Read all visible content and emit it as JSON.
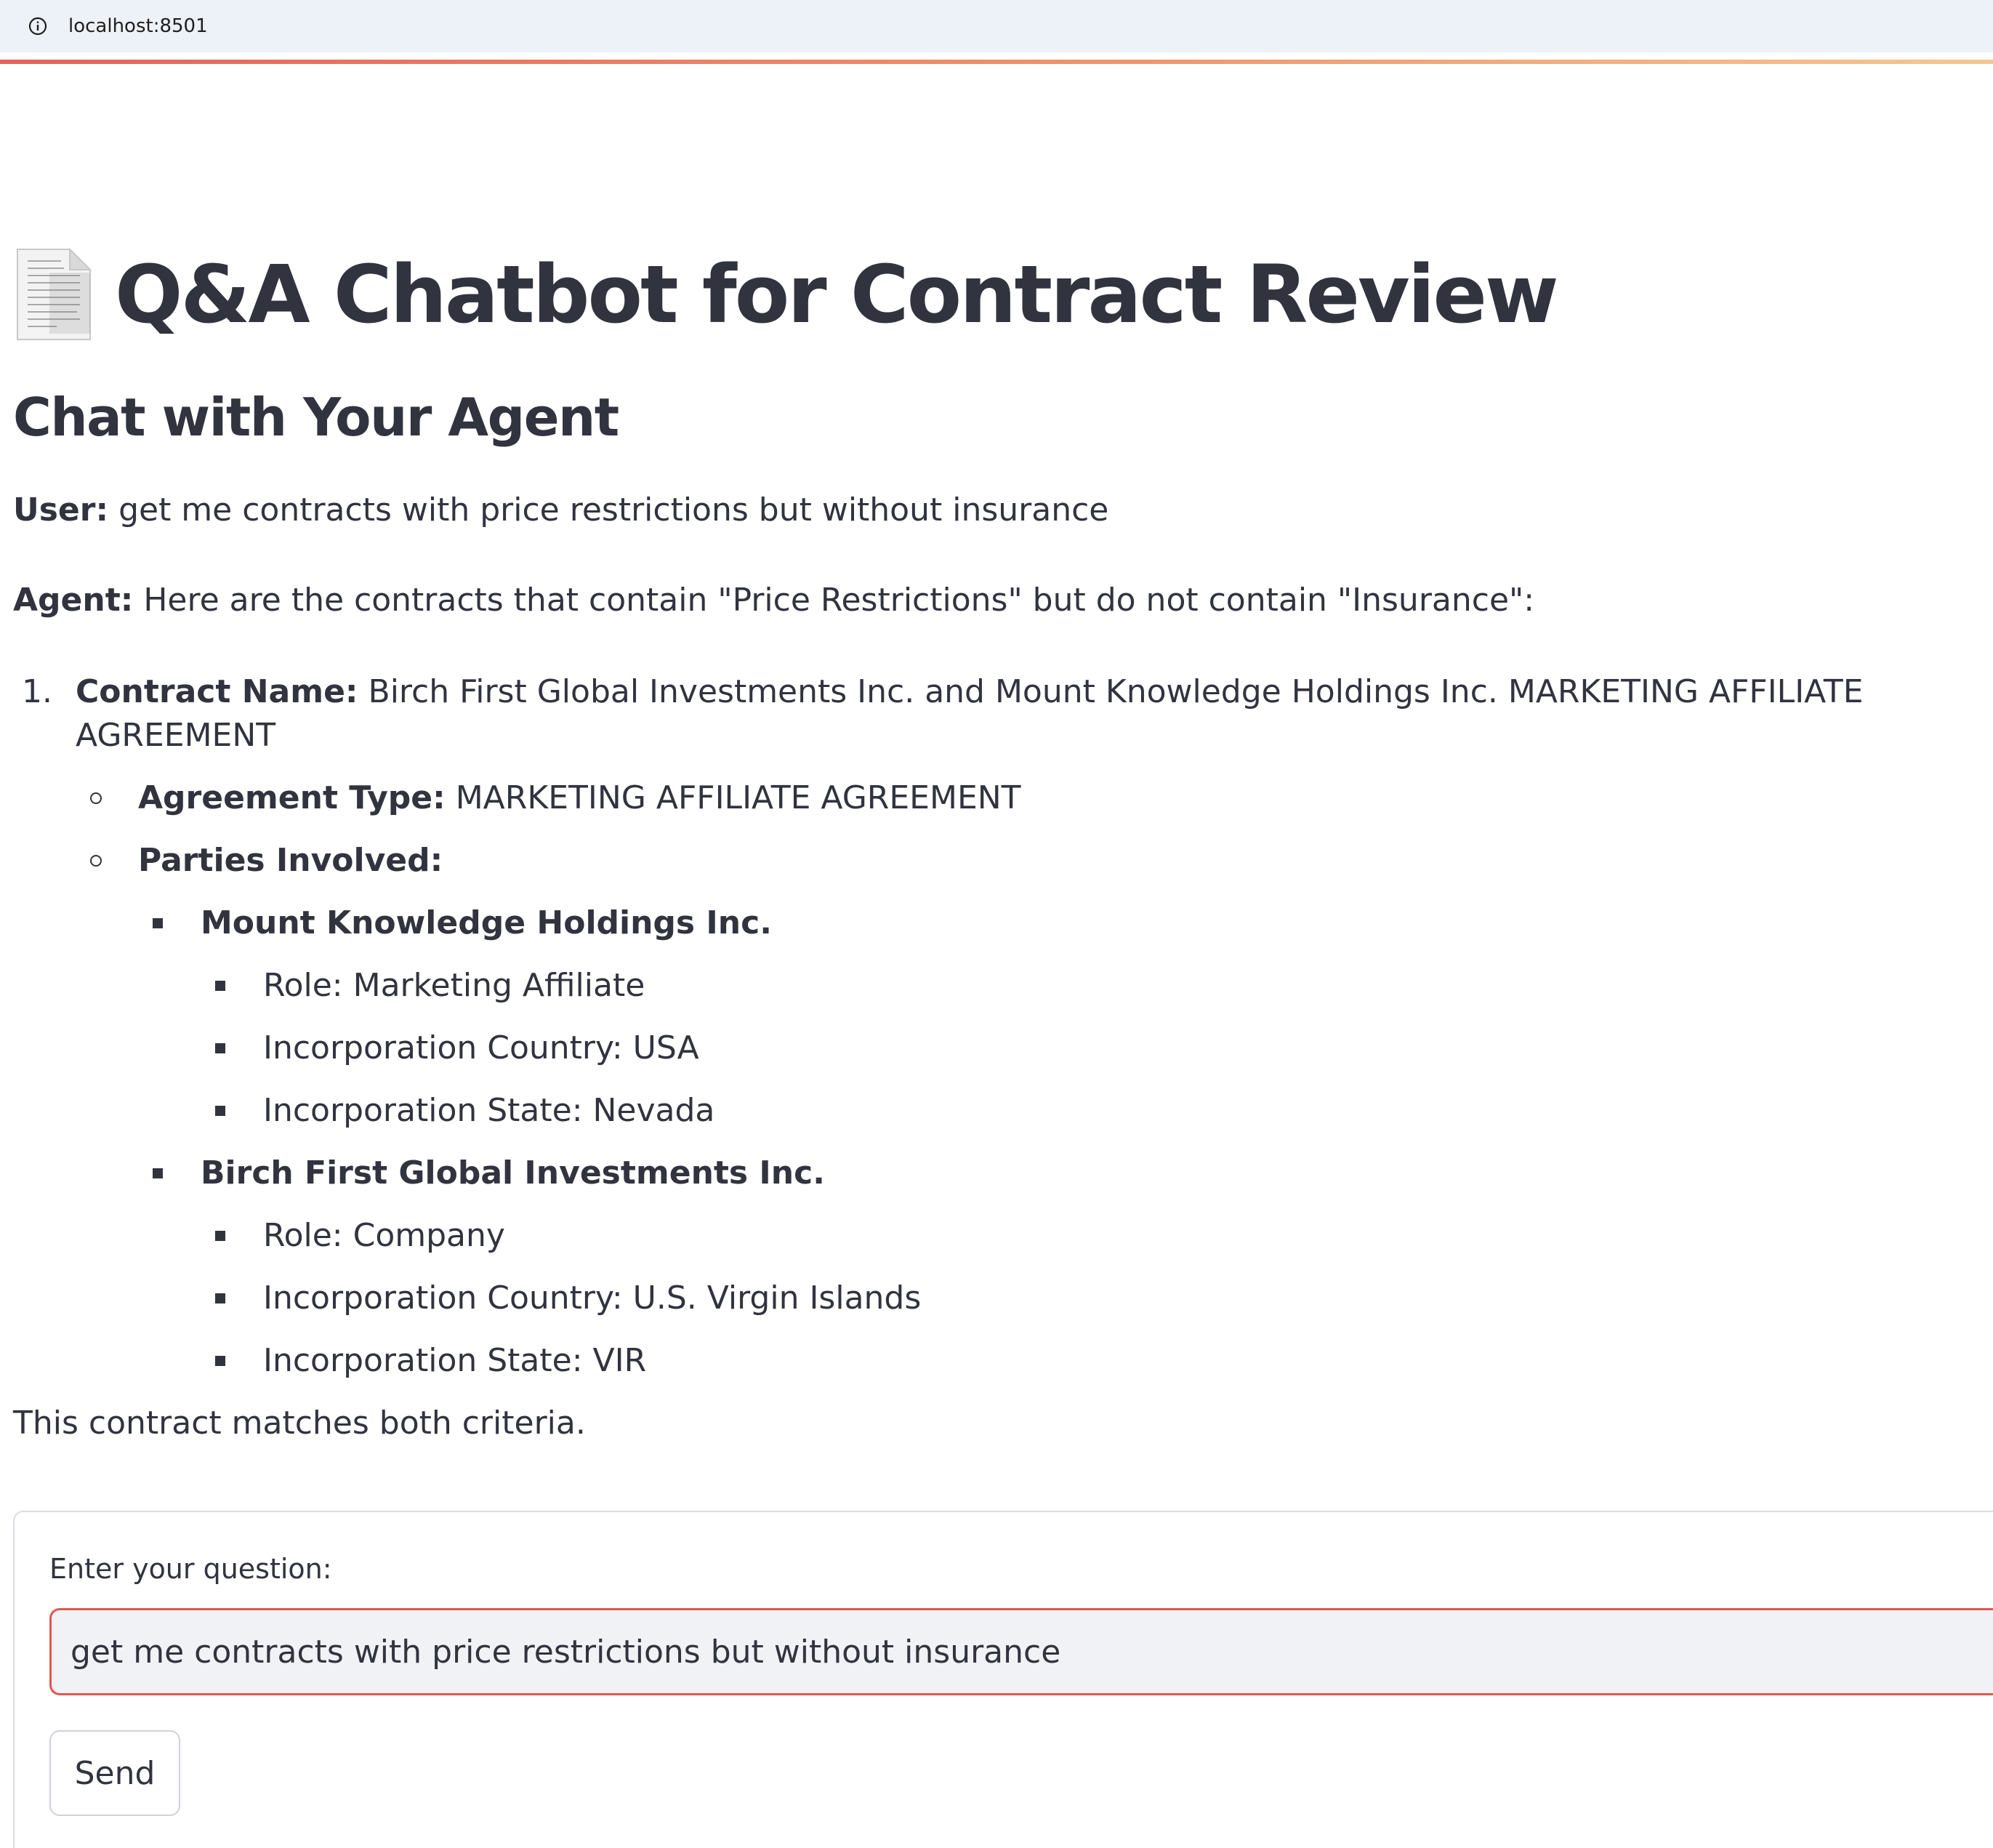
{
  "browser": {
    "url": "localhost:8501"
  },
  "header": {
    "title": "Q&A Chatbot for Contract Review",
    "title_icon": "page-facing-up-icon"
  },
  "chat": {
    "subheader": "Chat with Your Agent",
    "user_label": "User:",
    "user_message": "get me contracts with price restrictions but without insurance",
    "agent_label": "Agent:",
    "agent_intro": "Here are the contracts that contain \"Price Restrictions\" but do not contain \"Insurance\":",
    "contracts": [
      {
        "number": "1.",
        "name_label": "Contract Name:",
        "name": "Birch First Global Investments Inc. and Mount Knowledge Holdings Inc. MARKETING AFFILIATE AGREEMENT",
        "type_label": "Agreement Type:",
        "type": "MARKETING AFFILIATE AGREEMENT",
        "parties_label": "Parties Involved:",
        "parties": [
          {
            "name": "Mount Knowledge Holdings Inc.",
            "details": [
              "Role: Marketing Affiliate",
              "Incorporation Country: USA",
              "Incorporation State: Nevada"
            ]
          },
          {
            "name": "Birch First Global Investments Inc.",
            "details": [
              "Role: Company",
              "Incorporation Country: U.S. Virgin Islands",
              "Incorporation State: VIR"
            ]
          }
        ]
      }
    ],
    "agent_footer": "This contract matches both criteria."
  },
  "form": {
    "input_label": "Enter your question:",
    "input_value": "get me contracts with price restrictions but without insurance",
    "send_label": "Send"
  },
  "colors": {
    "text": "#31333f",
    "accent": "#e0574f",
    "input_bg": "#f0f2f6",
    "addr_bar_bg": "#edf1f8"
  }
}
